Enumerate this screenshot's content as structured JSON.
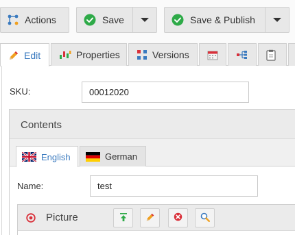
{
  "toolbar": {
    "actions_label": "Actions",
    "save_label": "Save",
    "save_publish_label": "Save & Publish"
  },
  "tabs": [
    {
      "label": "Edit",
      "icon": "pencil-icon"
    },
    {
      "label": "Properties",
      "icon": "properties-icon"
    },
    {
      "label": "Versions",
      "icon": "versions-icon"
    },
    {
      "label": "",
      "icon": "calendar-icon"
    },
    {
      "label": "",
      "icon": "dependencies-icon"
    },
    {
      "label": "",
      "icon": "clipboard-icon"
    }
  ],
  "form": {
    "sku_label": "SKU:",
    "sku_value": "00012020"
  },
  "contents": {
    "title": "Contents",
    "languages": [
      {
        "label": "English",
        "flag": "uk-flag"
      },
      {
        "label": "German",
        "flag": "germany-flag"
      }
    ],
    "name_label": "Name:",
    "name_value": "test",
    "picture": {
      "title": "Picture",
      "buttons": [
        "upload-icon",
        "edit-icon",
        "remove-icon",
        "search-icon"
      ]
    }
  },
  "colors": {
    "accent_blue": "#3a7abf",
    "publish_green": "#2eaa48",
    "remove_red": "#d9303a",
    "edit_orange": "#f0a020"
  }
}
